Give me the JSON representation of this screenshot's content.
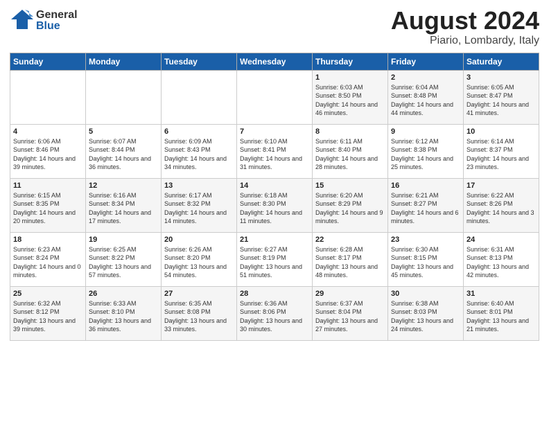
{
  "header": {
    "month_year": "August 2024",
    "location": "Piario, Lombardy, Italy",
    "logo_general": "General",
    "logo_blue": "Blue"
  },
  "days_of_week": [
    "Sunday",
    "Monday",
    "Tuesday",
    "Wednesday",
    "Thursday",
    "Friday",
    "Saturday"
  ],
  "weeks": [
    [
      {
        "day": "",
        "info": ""
      },
      {
        "day": "",
        "info": ""
      },
      {
        "day": "",
        "info": ""
      },
      {
        "day": "",
        "info": ""
      },
      {
        "day": "1",
        "info": "Sunrise: 6:03 AM\nSunset: 8:50 PM\nDaylight: 14 hours and 46 minutes."
      },
      {
        "day": "2",
        "info": "Sunrise: 6:04 AM\nSunset: 8:48 PM\nDaylight: 14 hours and 44 minutes."
      },
      {
        "day": "3",
        "info": "Sunrise: 6:05 AM\nSunset: 8:47 PM\nDaylight: 14 hours and 41 minutes."
      }
    ],
    [
      {
        "day": "4",
        "info": "Sunrise: 6:06 AM\nSunset: 8:46 PM\nDaylight: 14 hours and 39 minutes."
      },
      {
        "day": "5",
        "info": "Sunrise: 6:07 AM\nSunset: 8:44 PM\nDaylight: 14 hours and 36 minutes."
      },
      {
        "day": "6",
        "info": "Sunrise: 6:09 AM\nSunset: 8:43 PM\nDaylight: 14 hours and 34 minutes."
      },
      {
        "day": "7",
        "info": "Sunrise: 6:10 AM\nSunset: 8:41 PM\nDaylight: 14 hours and 31 minutes."
      },
      {
        "day": "8",
        "info": "Sunrise: 6:11 AM\nSunset: 8:40 PM\nDaylight: 14 hours and 28 minutes."
      },
      {
        "day": "9",
        "info": "Sunrise: 6:12 AM\nSunset: 8:38 PM\nDaylight: 14 hours and 25 minutes."
      },
      {
        "day": "10",
        "info": "Sunrise: 6:14 AM\nSunset: 8:37 PM\nDaylight: 14 hours and 23 minutes."
      }
    ],
    [
      {
        "day": "11",
        "info": "Sunrise: 6:15 AM\nSunset: 8:35 PM\nDaylight: 14 hours and 20 minutes."
      },
      {
        "day": "12",
        "info": "Sunrise: 6:16 AM\nSunset: 8:34 PM\nDaylight: 14 hours and 17 minutes."
      },
      {
        "day": "13",
        "info": "Sunrise: 6:17 AM\nSunset: 8:32 PM\nDaylight: 14 hours and 14 minutes."
      },
      {
        "day": "14",
        "info": "Sunrise: 6:18 AM\nSunset: 8:30 PM\nDaylight: 14 hours and 11 minutes."
      },
      {
        "day": "15",
        "info": "Sunrise: 6:20 AM\nSunset: 8:29 PM\nDaylight: 14 hours and 9 minutes."
      },
      {
        "day": "16",
        "info": "Sunrise: 6:21 AM\nSunset: 8:27 PM\nDaylight: 14 hours and 6 minutes."
      },
      {
        "day": "17",
        "info": "Sunrise: 6:22 AM\nSunset: 8:26 PM\nDaylight: 14 hours and 3 minutes."
      }
    ],
    [
      {
        "day": "18",
        "info": "Sunrise: 6:23 AM\nSunset: 8:24 PM\nDaylight: 14 hours and 0 minutes."
      },
      {
        "day": "19",
        "info": "Sunrise: 6:25 AM\nSunset: 8:22 PM\nDaylight: 13 hours and 57 minutes."
      },
      {
        "day": "20",
        "info": "Sunrise: 6:26 AM\nSunset: 8:20 PM\nDaylight: 13 hours and 54 minutes."
      },
      {
        "day": "21",
        "info": "Sunrise: 6:27 AM\nSunset: 8:19 PM\nDaylight: 13 hours and 51 minutes."
      },
      {
        "day": "22",
        "info": "Sunrise: 6:28 AM\nSunset: 8:17 PM\nDaylight: 13 hours and 48 minutes."
      },
      {
        "day": "23",
        "info": "Sunrise: 6:30 AM\nSunset: 8:15 PM\nDaylight: 13 hours and 45 minutes."
      },
      {
        "day": "24",
        "info": "Sunrise: 6:31 AM\nSunset: 8:13 PM\nDaylight: 13 hours and 42 minutes."
      }
    ],
    [
      {
        "day": "25",
        "info": "Sunrise: 6:32 AM\nSunset: 8:12 PM\nDaylight: 13 hours and 39 minutes."
      },
      {
        "day": "26",
        "info": "Sunrise: 6:33 AM\nSunset: 8:10 PM\nDaylight: 13 hours and 36 minutes."
      },
      {
        "day": "27",
        "info": "Sunrise: 6:35 AM\nSunset: 8:08 PM\nDaylight: 13 hours and 33 minutes."
      },
      {
        "day": "28",
        "info": "Sunrise: 6:36 AM\nSunset: 8:06 PM\nDaylight: 13 hours and 30 minutes."
      },
      {
        "day": "29",
        "info": "Sunrise: 6:37 AM\nSunset: 8:04 PM\nDaylight: 13 hours and 27 minutes."
      },
      {
        "day": "30",
        "info": "Sunrise: 6:38 AM\nSunset: 8:03 PM\nDaylight: 13 hours and 24 minutes."
      },
      {
        "day": "31",
        "info": "Sunrise: 6:40 AM\nSunset: 8:01 PM\nDaylight: 13 hours and 21 minutes."
      }
    ]
  ]
}
